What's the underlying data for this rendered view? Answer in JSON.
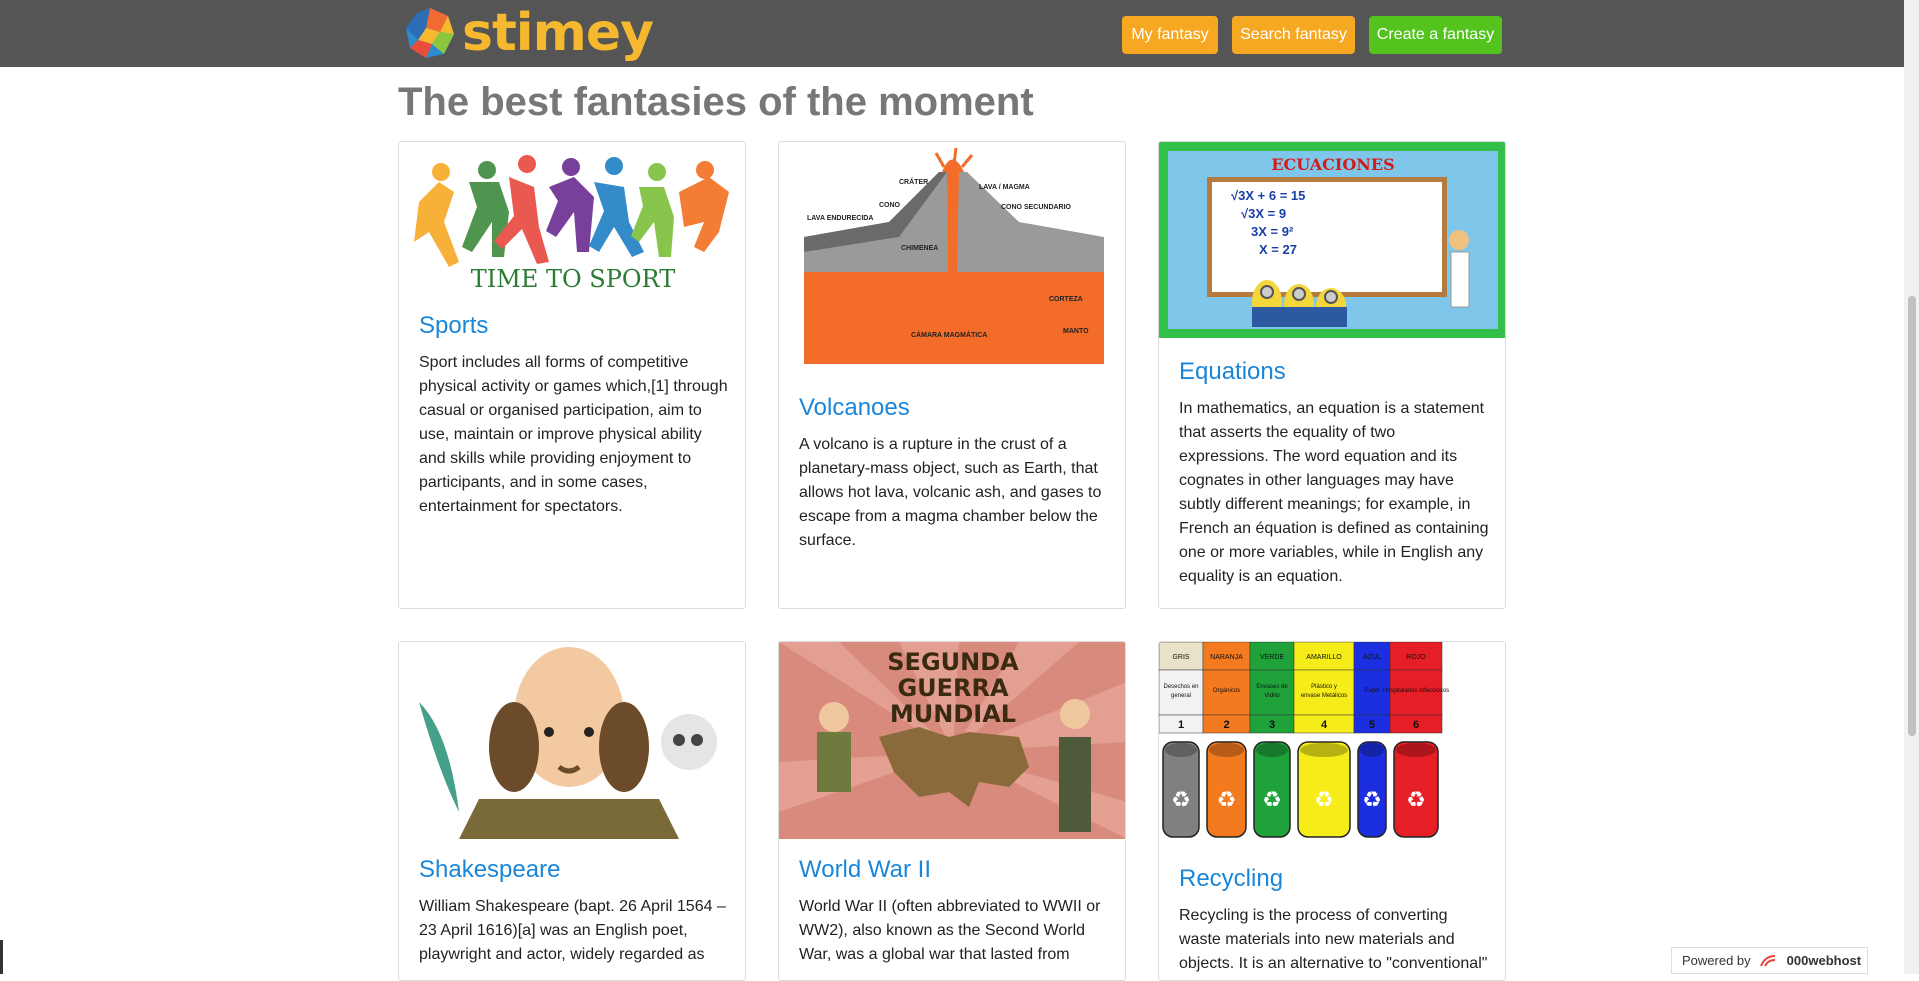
{
  "nav": {
    "brand": "stimey",
    "buttons": [
      "My fantasy",
      "Search fantasy",
      "Create a fantasy"
    ]
  },
  "page": {
    "title": "The best fantasies of the moment"
  },
  "cards": [
    {
      "title": "Sports",
      "image_caption": "TIME TO SPORT",
      "text": "Sport includes all forms of competitive physical activity or games which,[1] through casual or organised participation, aim to use, maintain or improve physical ability and skills while providing enjoyment to participants, and in some cases, entertainment for spectators."
    },
    {
      "title": "Volcanoes",
      "image_labels": [
        "CRÁTER",
        "LAVA / MAGMA",
        "CONO",
        "LAVA ENDURECIDA",
        "CONO SECUNDARIO",
        "CHIMENEA",
        "CORTEZA",
        "MANTO",
        "CÁMARA MAGMÁTICA"
      ],
      "text": "A volcano is a rupture in the crust of a planetary-mass object, such as Earth, that allows hot lava, volcanic ash, and gases to escape from a magma chamber below the surface."
    },
    {
      "title": "Equations",
      "image_caption": "ECUACIONES",
      "board_lines": [
        "√3X + 6 = 15",
        "√3X = 9",
        "3X = 9²",
        "X = 27"
      ],
      "text": "In mathematics, an equation is a statement that asserts the equality of two expressions. The word equation and its cognates in other languages may have subtly different meanings; for example, in French an équation is defined as containing one or more variables, while in English any equality is an equation."
    },
    {
      "title": "Shakespeare",
      "text": "William Shakespeare (bapt. 26 April 1564 – 23 April 1616)[a] was an English poet, playwright and actor, widely regarded as"
    },
    {
      "title": "World War II",
      "image_caption": "SEGUNDA GUERRA MUNDIAL",
      "text": "World War II (often abbreviated to WWII or WW2), also known as the Second World War, was a global war that lasted from"
    },
    {
      "title": "Recycling",
      "recycle_columns": [
        {
          "color": "GRIS",
          "item": "Desechos en general",
          "num": "1",
          "hex": "#808080"
        },
        {
          "color": "NARANJA",
          "item": "Orgánicos",
          "num": "2",
          "hex": "#f47a20"
        },
        {
          "color": "VERDE",
          "item": "Envases de Vidrio",
          "num": "3",
          "hex": "#1fa23a"
        },
        {
          "color": "AMARILLO",
          "item": "Plástico y envase Metálicos",
          "num": "4",
          "hex": "#f5ec1a"
        },
        {
          "color": "AZUL",
          "item": "Papel",
          "num": "5",
          "hex": "#1b2fe0"
        },
        {
          "color": "ROJO",
          "item": "Hospitalarios Infecciosos",
          "num": "6",
          "hex": "#e61e25"
        }
      ],
      "text": "Recycling is the process of converting waste materials into new materials and objects. It is an alternative to \"conventional\""
    }
  ],
  "footer": {
    "powered_by": "Powered by",
    "host": "000webhost"
  },
  "colors": {
    "navbar": "#555555",
    "accent_orange": "#f7a823",
    "accent_green": "#55c31e",
    "link_blue": "#1a86d9"
  }
}
